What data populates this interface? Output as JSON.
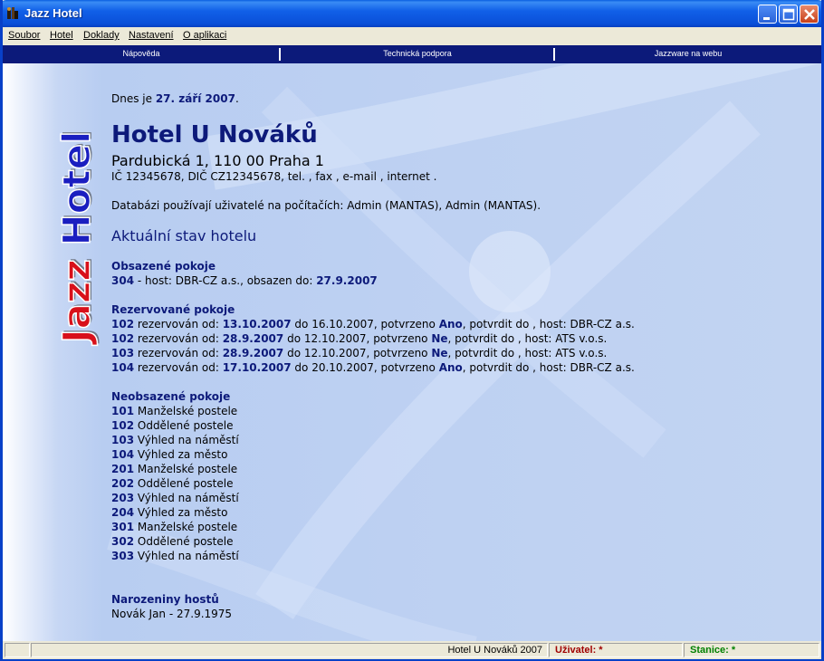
{
  "window": {
    "title": "Jazz Hotel"
  },
  "menu": [
    {
      "label": "Soubor"
    },
    {
      "label": "Hotel"
    },
    {
      "label": "Doklady"
    },
    {
      "label": "Nastavení"
    },
    {
      "label": "O aplikaci"
    }
  ],
  "links": [
    "Nápověda",
    "Technická podpora",
    "Jazzware na webu"
  ],
  "logo_text": "Jazz Hotel",
  "today": {
    "prefix": "Dnes je ",
    "date": "27. září 2007",
    "suffix": "."
  },
  "hotel": {
    "name": "Hotel U Nováků",
    "address": "Pardubická 1, 110 00 Praha 1",
    "ids": "IČ 12345678, DIČ CZ12345678, tel. , fax , e-mail , internet ."
  },
  "db_users": "Databázi používají uživatelé na počítačích: Admin (MANTAS), Admin (MANTAS).",
  "status_heading": "Aktuální stav hotelu",
  "occupied": {
    "heading": "Obsazené pokoje",
    "rows": [
      {
        "room": "304",
        "text": " - host: DBR-CZ a.s., obsazen do: ",
        "date": "27.9.2007"
      }
    ]
  },
  "reserved": {
    "heading": "Rezervované pokoje",
    "rows": [
      {
        "room": "102",
        "t1": " rezervován od: ",
        "from": "13.10.2007",
        "t2": " do 16.10.2007, potvrzeno ",
        "confirmed": "Ano",
        "t3": ", potvrdit do , host: DBR-CZ a.s."
      },
      {
        "room": "102",
        "t1": " rezervován od: ",
        "from": "28.9.2007",
        "t2": " do 12.10.2007, potvrzeno ",
        "confirmed": "Ne",
        "t3": ", potvrdit do , host: ATS v.o.s."
      },
      {
        "room": "103",
        "t1": " rezervován od: ",
        "from": "28.9.2007",
        "t2": " do 12.10.2007, potvrzeno ",
        "confirmed": "Ne",
        "t3": ", potvrdit do , host: ATS v.o.s."
      },
      {
        "room": "104",
        "t1": " rezervován od: ",
        "from": "17.10.2007",
        "t2": " do 20.10.2007, potvrzeno ",
        "confirmed": "Ano",
        "t3": ", potvrdit do , host: DBR-CZ a.s."
      }
    ]
  },
  "free": {
    "heading": "Neobsazené pokoje",
    "rows": [
      {
        "room": "101",
        "desc": " Manželské postele"
      },
      {
        "room": "102",
        "desc": " Oddělené postele"
      },
      {
        "room": "103",
        "desc": " Výhled na náměstí"
      },
      {
        "room": "104",
        "desc": " Výhled za město"
      },
      {
        "room": "201",
        "desc": " Manželské postele"
      },
      {
        "room": "202",
        "desc": " Oddělené postele"
      },
      {
        "room": "203",
        "desc": " Výhled na náměstí"
      },
      {
        "room": "204",
        "desc": " Výhled za město"
      },
      {
        "room": "301",
        "desc": " Manželské postele"
      },
      {
        "room": "302",
        "desc": " Oddělené postele"
      },
      {
        "room": "303",
        "desc": " Výhled na náměstí"
      }
    ]
  },
  "birthdays": {
    "heading": "Narozeniny hostů",
    "rows": [
      "Novák Jan - 27.9.1975"
    ]
  },
  "statusbar": {
    "hotel": "Hotel U Nováků 2007",
    "user": "Uživatel: *",
    "station": "Stanice: *"
  },
  "colors": {
    "navy": "#0d1a7a",
    "logo_red": "#d8101a",
    "user_red": "#a00000",
    "station_green": "#008000"
  }
}
